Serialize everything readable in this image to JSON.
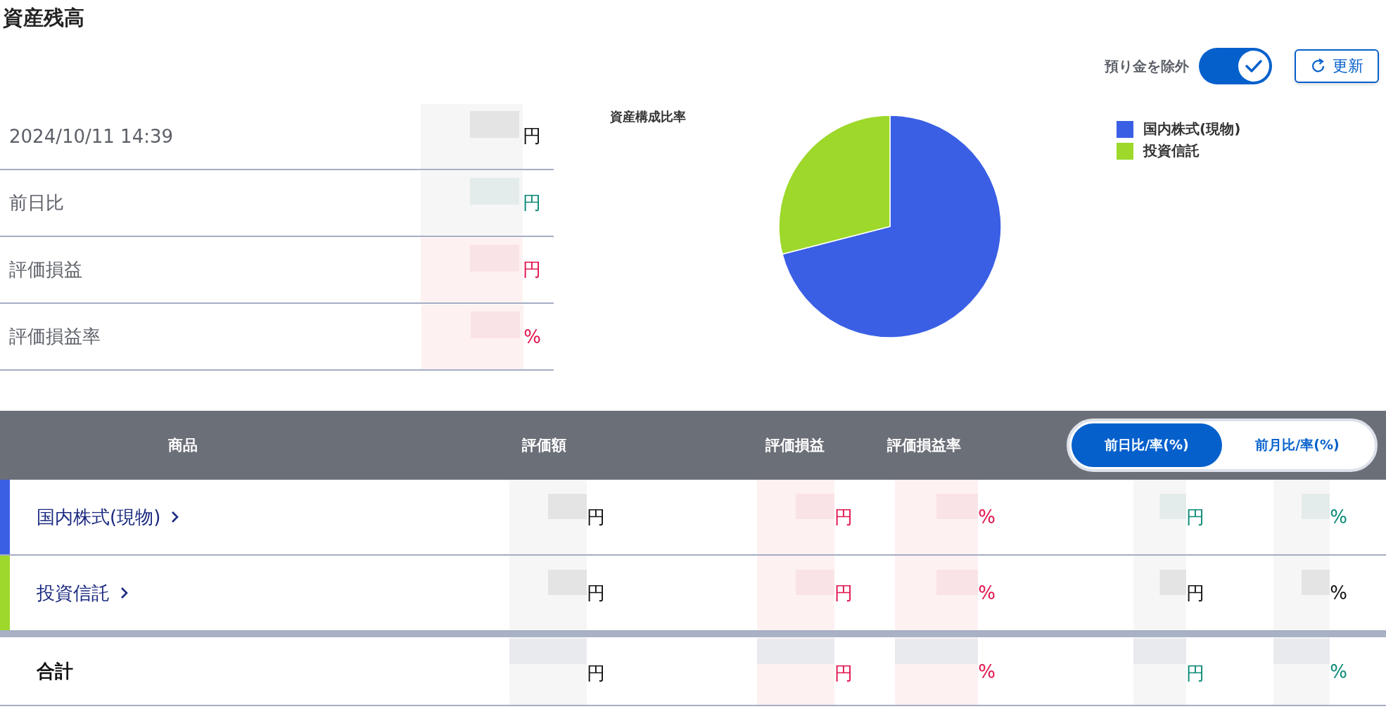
{
  "title": "資産残高",
  "controls": {
    "exclude_deposit": {
      "label": "預り金を除外",
      "on": true
    },
    "refresh_button": "更新"
  },
  "summary": [
    {
      "label": "2024/10/11 14:39",
      "value": "円",
      "color": "#111111"
    },
    {
      "label": "前日比",
      "value": "円",
      "color": "#0c8a78"
    },
    {
      "label": "評価損益",
      "value": "円",
      "color": "#e0154d"
    },
    {
      "label": "評価損益率",
      "value": "%",
      "color": "#e0154d"
    }
  ],
  "composition": {
    "title": "資産構成比率",
    "legend": [
      {
        "label": "国内株式(現物)",
        "color": "#3a5fe5"
      },
      {
        "label": "投資信託",
        "color": "#9dd82b"
      }
    ]
  },
  "table": {
    "columns": [
      "商品",
      "評価額",
      "評価損益",
      "評価損益率"
    ],
    "period_tabs": [
      {
        "label": "前日比/率(%)",
        "selected": true
      },
      {
        "label": "前月比/率(%)",
        "selected": false
      }
    ],
    "rows": [
      {
        "name": "国内株式(現物)",
        "color": "#3a5fe5",
        "cells": [
          {
            "text": "円",
            "color": "#111111"
          },
          {
            "text": "円",
            "color": "#e0154d"
          },
          {
            "text": "%",
            "color": "#e0154d"
          },
          {
            "text": "円",
            "color": "#0c8a78"
          },
          {
            "text": "%",
            "color": "#0c8a78"
          }
        ]
      },
      {
        "name": "投資信託",
        "color": "#9dd82b",
        "cells": [
          {
            "text": "円",
            "color": "#111111"
          },
          {
            "text": "円",
            "color": "#e0154d"
          },
          {
            "text": "%",
            "color": "#e0154d"
          },
          {
            "text": "円",
            "color": "#111111"
          },
          {
            "text": "%",
            "color": "#111111"
          }
        ]
      }
    ],
    "total": {
      "label": "合計",
      "cells": [
        {
          "text": "円",
          "color": "#111111"
        },
        {
          "text": "円",
          "color": "#e0154d"
        },
        {
          "text": "%",
          "color": "#e0154d"
        },
        {
          "text": "円",
          "color": "#0c8a78"
        },
        {
          "text": "%",
          "color": "#0c8a78"
        }
      ]
    }
  }
}
